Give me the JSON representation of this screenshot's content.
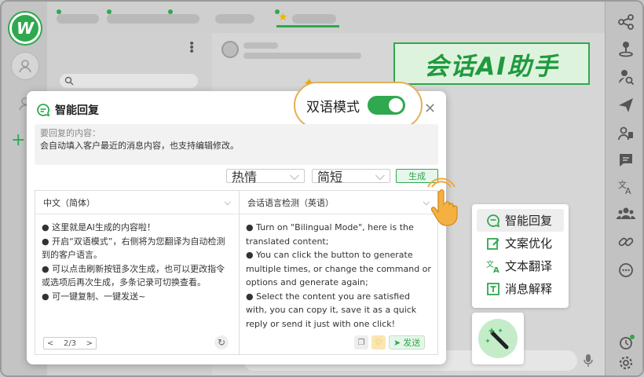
{
  "app": {
    "logo_letter": "W"
  },
  "banner": {
    "text": "会话AI助手"
  },
  "dialog": {
    "title": "智能回复",
    "bilingual_label": "双语模式",
    "bilingual_on": true,
    "source_hint": "要回复的内容：",
    "source_text": "会自动填入客户最近的消息内容，也支持编辑修改。",
    "tone_select": "热情",
    "length_select": "简短",
    "generate_label": "生成",
    "left_pane": {
      "language": "中文（简体）",
      "lines": [
        "● 这里就是AI生成的内容啦！",
        "● 开启“双语模式”，右侧将为您翻译为自动检测到的客户语言。",
        "● 可以点击刷新按钮多次生成，也可以更改指令或选项后再次生成，多条记录可切换查看。",
        "● 可一键复制、一键发送~"
      ],
      "pager": {
        "prev": "<",
        "current": "2/3",
        "next": ">"
      }
    },
    "right_pane": {
      "language": "会话语言检测（英语）",
      "lines": [
        "● Turn on \"Bilingual Mode\", here is the translated content;",
        "● You can click the button to generate multiple times, or change the command or options and generate again;",
        "● Select the content you are satisfied with, you can copy it, save it as a quick reply or send it just with one click!"
      ],
      "send_label": "发送"
    }
  },
  "feature_menu": {
    "items": [
      {
        "label": "智能回复",
        "icon": "chat-icon",
        "active": true
      },
      {
        "label": "文案优化",
        "icon": "edit-icon",
        "active": false
      },
      {
        "label": "文本翻译",
        "icon": "translate-icon",
        "active": false
      },
      {
        "label": "消息解释",
        "icon": "text-icon",
        "active": false
      }
    ]
  },
  "colors": {
    "accent": "#2fa84f",
    "highlight": "#e2b05a"
  }
}
